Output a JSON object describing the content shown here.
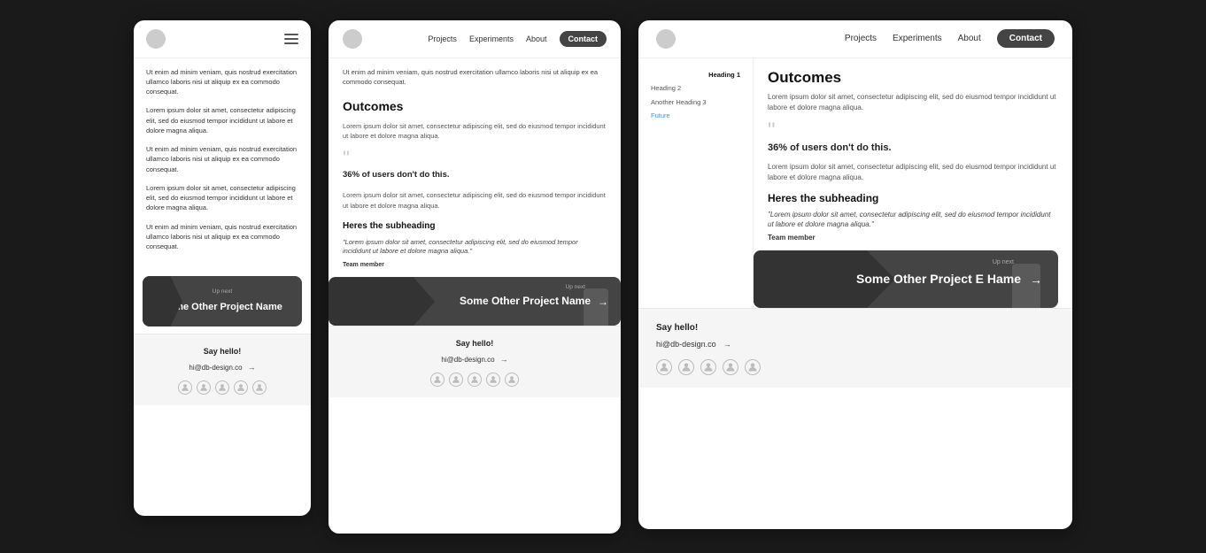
{
  "screens": {
    "narrow": {
      "header": {
        "menu_icon": "hamburger-icon"
      },
      "content": {
        "para1": "Ut enim ad minim veniam, quis nostrud exercitation ullamco laboris nisi ut aliquip ex ea commodo consequat.",
        "para2": "Lorem ipsum dolor sit amet, consectetur adipiscing elit, sed do eiusmod tempor incididunt ut labore et dolore magna aliqua.",
        "para3": "Ut enim ad minim veniam, quis nostrud exercitation ullamco laboris nisi ut aliquip ex ea commodo consequat.",
        "para4": "Lorem ipsum dolor sit amet, consectetur adipiscing elit, sed do eiusmod tempor incididunt ut labore et dolore magna aliqua.",
        "para5": "Ut enim ad minim veniam, quis nostrud exercitation ullamco laboris nisi ut aliquip ex ea commodo consequat."
      },
      "cta": {
        "up_next": "Up next",
        "project_name": "Some Other Project Name"
      },
      "footer": {
        "title": "Say hello!",
        "email": "hi@db-design.co",
        "arrow": "→"
      }
    },
    "mid": {
      "nav": {
        "projects": "Projects",
        "experiments": "Experiments",
        "about": "About",
        "contact": "Contact"
      },
      "content": {
        "intro": "Ut enim ad minim veniam, quis nostrud exercitation ullamco laboris nisi ut aliquip ex ea commodo consequat.",
        "outcomes_heading": "Outcomes",
        "outcomes_body": "Lorem ipsum dolor sit amet, consectetur adipiscing elit, sed do eiusmod tempor incididunt ut labore et dolore magna aliqua.",
        "quote_text": "36% of users don't do this.",
        "quote_body": "Lorem ipsum dolor sit amet, consectetur adipiscing elit, sed do eiusmod tempor incididunt ut labore et dolore magna aliqua.",
        "subheading": "Heres the subheading",
        "blockquote": "\"Lorem ipsum dolor sit amet, consectetur adipiscing elit, sed do eiusmod tempor incididunt ut labore et dolore magna aliqua.\"",
        "team_member": "Team member"
      },
      "cta": {
        "up_next": "Up next",
        "project_name": "Some Other Project Name"
      },
      "footer": {
        "title": "Say hello!",
        "email": "hi@db-design.co",
        "arrow": "→"
      }
    },
    "wide": {
      "nav": {
        "projects": "Projects",
        "experiments": "Experiments",
        "about": "About",
        "contact": "Contact"
      },
      "sidebar": {
        "heading1": "Heading 1",
        "heading2": "Heading 2",
        "heading3": "Another Heading 3",
        "link": "Future"
      },
      "content": {
        "outcomes_heading": "Outcomes",
        "outcomes_body": "Lorem ipsum dolor sit amet, consectetur adipiscing elit, sed do eiusmod tempor incididunt ut labore et dolore magna aliqua.",
        "quote_text": "36% of users don't do this.",
        "quote_body": "Lorem ipsum dolor sit amet, consectetur adipiscing elit, sed do eiusmod tempor incididunt ut labore et dolore magna aliqua.",
        "subheading": "Heres the subheading",
        "blockquote": "\"Lorem ipsum dolor sit amet, consectetur adipiscing elit, sed do eiusmod tempor incididunt ut labore et dolore magna aliqua.\"",
        "team_member": "Team member"
      },
      "cta": {
        "up_next": "Up next",
        "project_name": "Some Other Project E Hame"
      },
      "footer": {
        "title": "Say hello!",
        "email": "hi@db-design.co",
        "arrow": "→"
      }
    }
  }
}
